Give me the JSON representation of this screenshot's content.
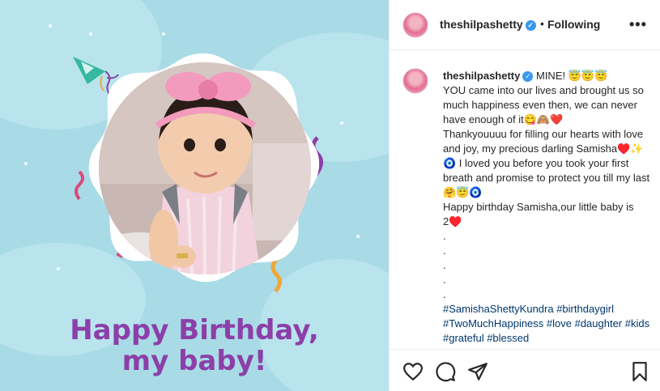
{
  "post": {
    "username": "theshilpashetty",
    "separator": "•",
    "follow_status": "Following",
    "more_label": "•••",
    "verified_glyph": "✓"
  },
  "image": {
    "headline_line1": "Happy Birthday,",
    "headline_line2": "my baby!",
    "colors": {
      "background": "#a9dbe6",
      "headline": "#8c3fa8",
      "bow": "#f29bbd"
    }
  },
  "caption": {
    "lines": [
      "MINE! 😇😇😇",
      "YOU came into our lives and brought us so much happiness even then, we can never have enough of it😋🙈❤️",
      "Thankyouuuu for filling our hearts with love and joy, my precious darling Samisha♥️✨🧿 I loved you before you took your first breath and promise to protect you till my last🤗😇🧿",
      "Happy birthday Samisha,our little baby is 2♥️",
      ".",
      ".",
      ".",
      ".",
      ".",
      "#SamishaShettyKundra #birthdaygirl #TwoMuchHappiness #love #daughter #kids #grateful #blessed"
    ]
  },
  "actions": {
    "icons": [
      "heart-icon",
      "comment-icon",
      "share-icon",
      "save-icon"
    ]
  }
}
